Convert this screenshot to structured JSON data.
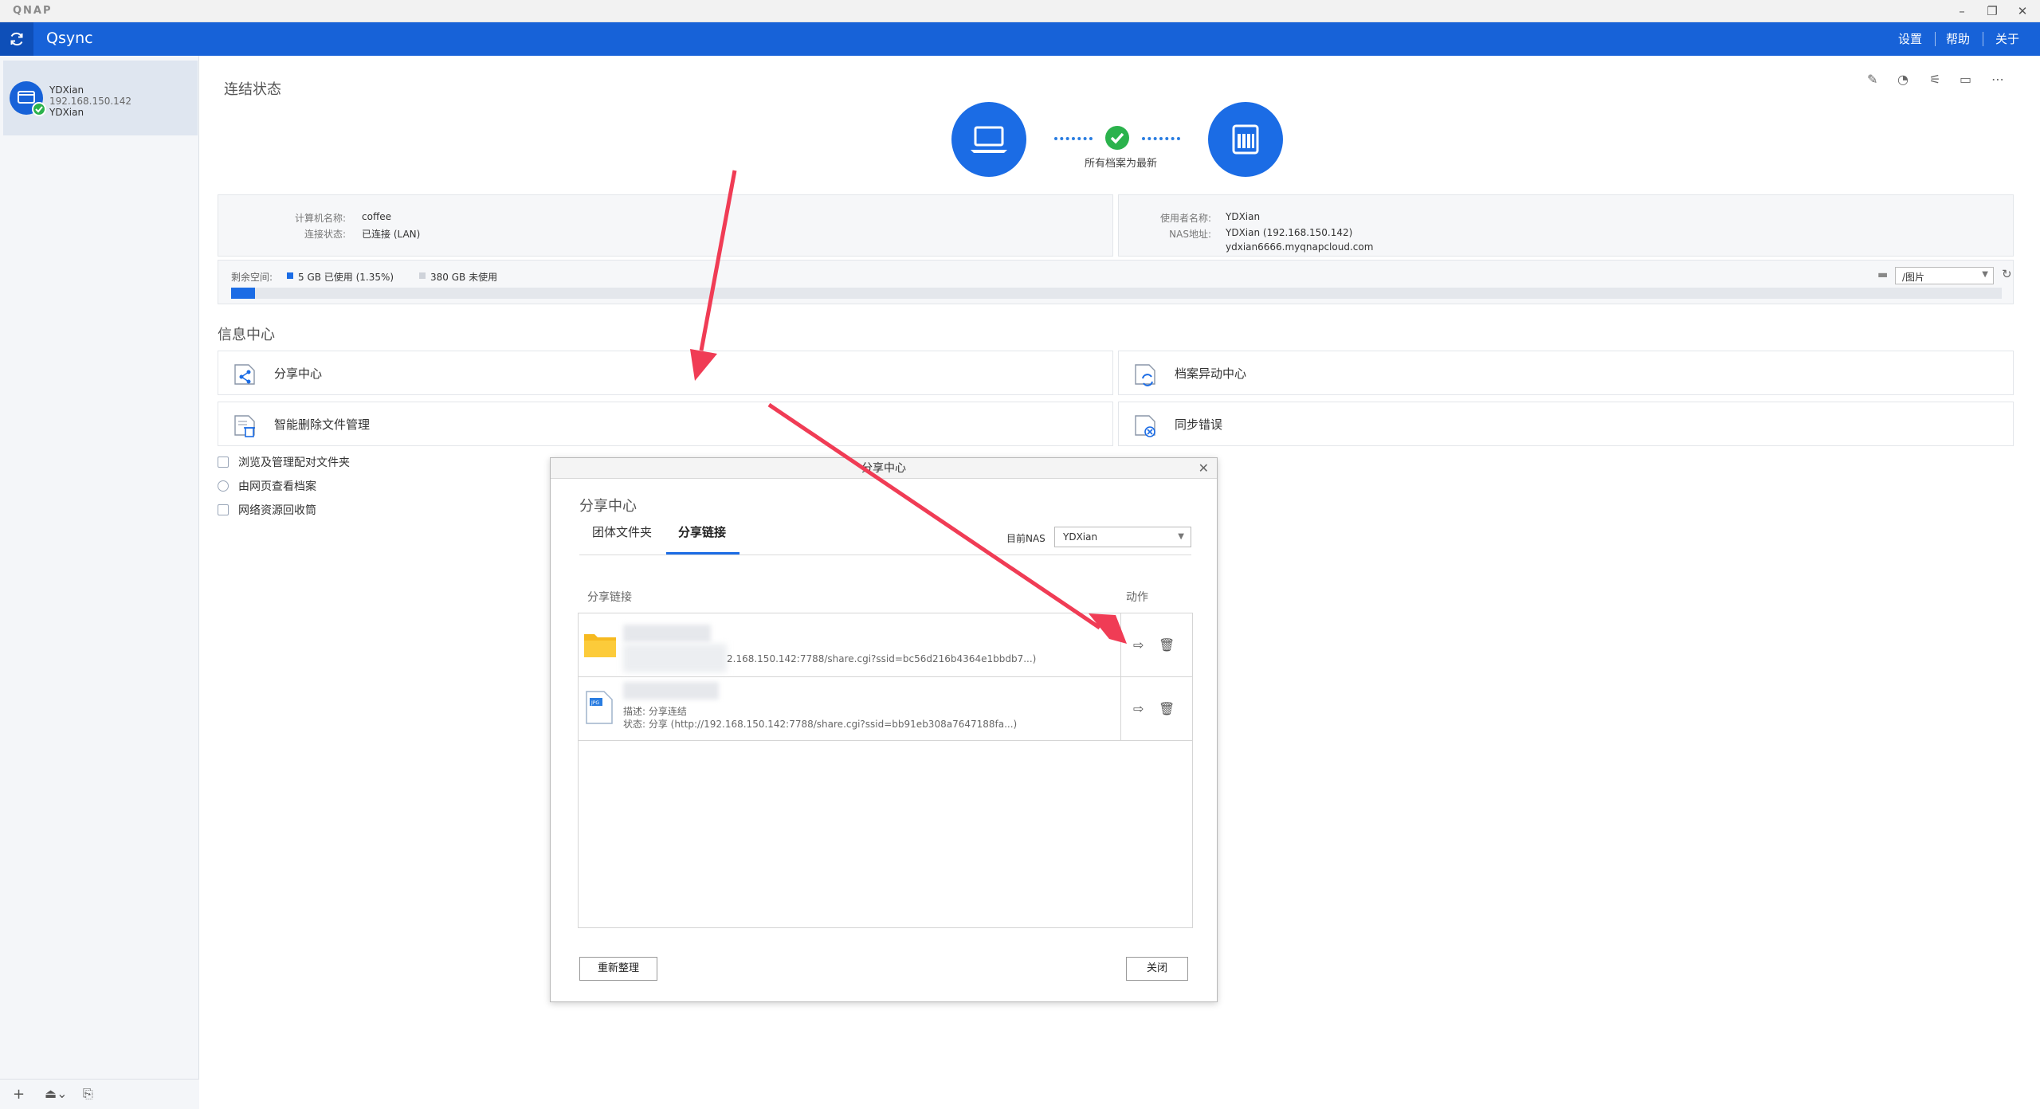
{
  "window": {
    "brand": "QNAP",
    "app_name": "Qsync",
    "nav": {
      "settings": "设置",
      "help": "帮助",
      "about": "关于"
    }
  },
  "server": {
    "name": "YDXian",
    "ip": "192.168.150.142",
    "user": "YDXian"
  },
  "connection": {
    "title": "连结状态",
    "status_caption": "所有档案为最新",
    "computer_name_label": "计算机名称:",
    "computer_name": "coffee",
    "conn_status_label": "连接状态:",
    "conn_status": "已连接 (LAN)",
    "username_label": "使用者名称:",
    "username": "YDXian",
    "nas_label": "NAS地址:",
    "nas_addr": "YDXian (192.168.150.142)",
    "nas_domain": "ydxian6666.myqnapcloud.com"
  },
  "disk": {
    "label": "剩余空间:",
    "used": "5 GB 已使用 (1.35%)",
    "free": "380  GB 未使用",
    "used_fraction": 0.0135,
    "folder": "/图片"
  },
  "info_center": {
    "title": "信息中心",
    "tiles": [
      "分享中心",
      "档案异动中心",
      "智能删除文件管理",
      "同步错误"
    ],
    "links": [
      "浏览及管理配对文件夹",
      "由网页查看档案",
      "网络资源回收筒"
    ]
  },
  "dialog": {
    "title": "分享中心",
    "heading": "分享中心",
    "tabs": [
      "团体文件夹",
      "分享链接"
    ],
    "nas_label": "目前NAS",
    "nas_value": "YDXian",
    "col_link": "分享链接",
    "col_action": "动作",
    "rows": [
      {
        "url": "2.168.150.142:7788/share.cgi?ssid=bc56d216b4364e1bbdb7...)"
      },
      {
        "desc": "描述:  分享连结",
        "status": "状态:  分享 (http://192.168.150.142:7788/share.cgi?ssid=bb91eb308a7647188fa...)"
      }
    ],
    "btn_refresh": "重新整理",
    "btn_close": "关闭"
  },
  "colors": {
    "accent": "#1762d8",
    "ok": "#2bb24c",
    "arrow": "#f03c55"
  }
}
